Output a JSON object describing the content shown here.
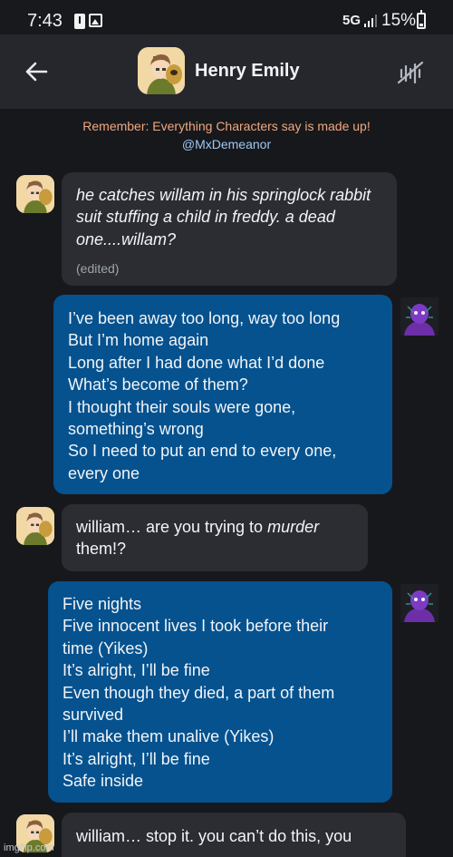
{
  "status_bar": {
    "time": "7:43",
    "network": "5G",
    "battery": "15%"
  },
  "header": {
    "character_name": "Henry Emily"
  },
  "banner": {
    "disclaimer": "Remember: Everything Characters say is made up!",
    "creator": "@MxDemeanor"
  },
  "messages": [
    {
      "sender": "character",
      "text": "he catches willam in his springlock rabbit suit stuffing a child in freddy. a dead one....willam?",
      "style": "italic",
      "note": "(edited)"
    },
    {
      "sender": "user",
      "text": "I’ve been away too long, way too long\nBut I’m home again\nLong after I had done what I’d done\nWhat’s become of them?\nI thought their souls were gone,\nsomething’s wrong\nSo I need to put an end to every one,\nevery one"
    },
    {
      "sender": "character",
      "text_before": "william… are you trying to ",
      "text_em": "murder",
      "text_after": "\nthem!?"
    },
    {
      "sender": "user",
      "text": "Five nights\nFive innocent lives I took before their\ntime (Yikes)\nIt’s alright, I’ll be fine\nEven though they died, a part of them\nsurvived\nI’ll make them unalive (Yikes)\nIt’s alright, I’ll be fine\nSafe inside"
    },
    {
      "sender": "character",
      "text": "william… stop it. you can’t do this, you"
    }
  ],
  "watermark": "imgflip.com",
  "colors": {
    "background": "#17181c",
    "header": "#25272d",
    "character_bubble": "#2b2d33",
    "user_bubble": "#05528f",
    "disclaimer": "#f0a87e",
    "creator": "#9cc8f4"
  },
  "icons": {
    "back": "arrow-left-icon",
    "voice": "voice-muted-icon"
  }
}
